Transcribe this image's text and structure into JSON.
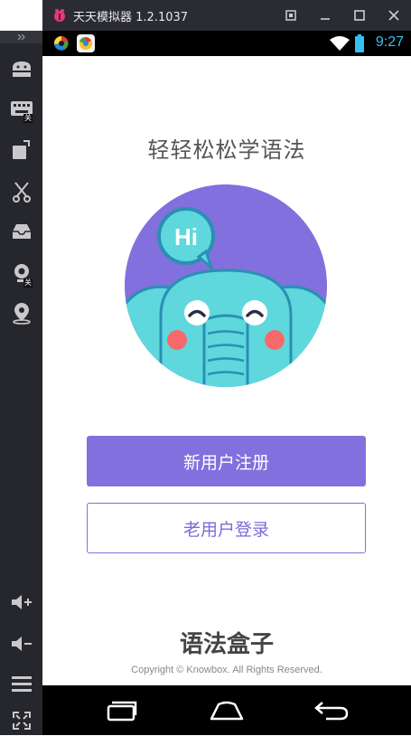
{
  "window": {
    "title": "天天模拟器 1.2.1037",
    "buttons": [
      "restore-icon",
      "minimize-icon",
      "maximize-icon",
      "close-icon"
    ]
  },
  "sidebar": {
    "tools": [
      {
        "icon": "android-icon",
        "badge": ""
      },
      {
        "icon": "keyboard-icon",
        "badge": "关"
      },
      {
        "icon": "rotate-screen-icon",
        "badge": ""
      },
      {
        "icon": "scissors-icon",
        "badge": ""
      },
      {
        "icon": "inbox-icon",
        "badge": ""
      },
      {
        "icon": "camera-icon",
        "badge": "关"
      },
      {
        "icon": "location-icon",
        "badge": ""
      },
      {
        "icon": "volume-up-icon",
        "badge": ""
      },
      {
        "icon": "volume-down-icon",
        "badge": ""
      },
      {
        "icon": "menu-icon",
        "badge": ""
      },
      {
        "icon": "fullscreen-icon",
        "badge": ""
      }
    ]
  },
  "statusbar": {
    "time": "9:27",
    "notification_icons": [
      "app-notification-icon",
      "chrome-notification-icon"
    ],
    "indicators": [
      "wifi-icon",
      "battery-icon"
    ]
  },
  "app": {
    "headline": "轻轻松松学语法",
    "mascot_bubble": "Hi",
    "register_label": "新用户注册",
    "login_label": "老用户登录",
    "brand": "语法盒子",
    "copyright": "Copyright © Knowbox. All Rights Reserved."
  },
  "navbar": {
    "buttons": [
      "recent-apps-icon",
      "home-icon",
      "back-icon"
    ]
  },
  "colors": {
    "accent": "#8170dd",
    "mascot_bg": "#8170dd",
    "mascot_body": "#5ed8dc",
    "status_clock": "#35c0f0"
  }
}
